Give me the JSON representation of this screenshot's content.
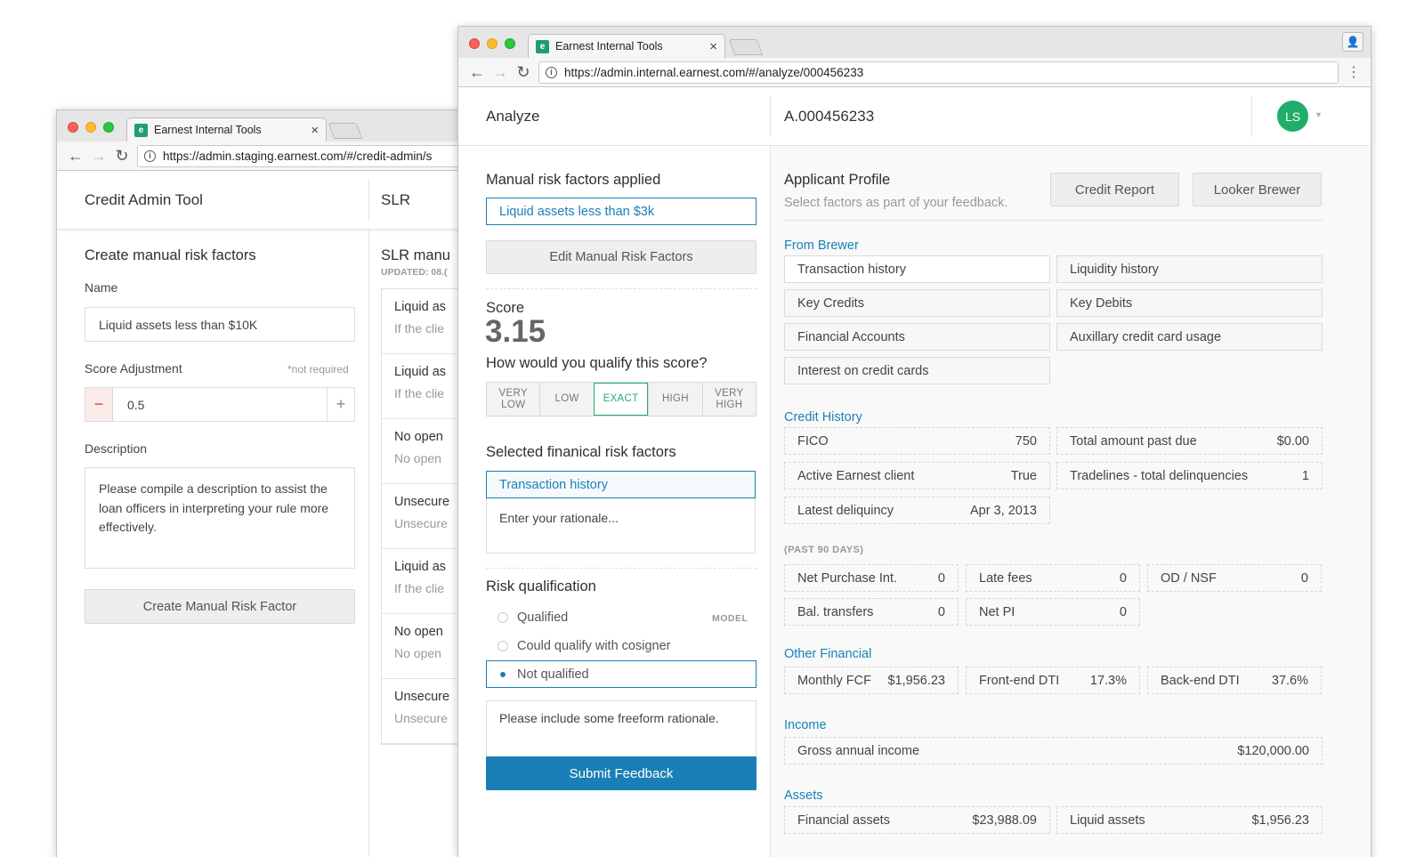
{
  "back_window": {
    "tab_title": "Earnest Internal Tools",
    "url": "https://admin.staging.earnest.com/#/credit-admin/s",
    "app_title": "Credit Admin Tool",
    "panel2_title": "SLR",
    "form": {
      "title": "Create manual risk factors",
      "name_label": "Name",
      "name_value": "Liquid assets less than $10K",
      "score_adj_label": "Score Adjustment",
      "not_required": "*not required",
      "score_value": "0.5",
      "minus": "−",
      "plus": "+",
      "description_label": "Description",
      "description_placeholder": "Please compile a description to assist the loan officers in interpreting your rule more effectively.",
      "create_button": "Create Manual Risk Factor"
    },
    "slr": {
      "title": "SLR manu",
      "updated": "UPDATED: 08.(",
      "items": [
        {
          "t": "Liquid as",
          "s": "If the clie"
        },
        {
          "t": "Liquid as",
          "s": "If the clie"
        },
        {
          "t": "No open",
          "s": "No open"
        },
        {
          "t": "Unsecure",
          "s": "Unsecure"
        },
        {
          "t": "Liquid as",
          "s": "If the clie"
        },
        {
          "t": "No open",
          "s": "No open"
        },
        {
          "t": "Unsecure",
          "s": "Unsecure"
        }
      ]
    }
  },
  "front_window": {
    "tab_title": "Earnest Internal Tools",
    "url": "https://admin.internal.earnest.com/#/analyze/000456233",
    "header": {
      "section": "Analyze",
      "app_id": "A.000456233",
      "avatar": "LS"
    },
    "left": {
      "manual_title": "Manual risk factors applied",
      "manual_selected": "Liquid assets less than $3k",
      "edit_button": "Edit Manual Risk Factors",
      "score_label": "Score",
      "score_value": "3.15",
      "qualify_question": "How would you qualify this score?",
      "qualify_options": [
        {
          "l1": "VERY",
          "l2": "LOW"
        },
        {
          "l1": "LOW",
          "l2": ""
        },
        {
          "l1": "EXACT",
          "l2": ""
        },
        {
          "l1": "HIGH",
          "l2": ""
        },
        {
          "l1": "VERY",
          "l2": "HIGH"
        }
      ],
      "qualify_selected": "EXACT",
      "selected_title": "Selected finanical risk factors",
      "selected_factor": "Transaction history",
      "rationale_placeholder": "Enter your rationale...",
      "risk_title": "Risk qualification",
      "model_tag": "MODEL",
      "risk_options": [
        "Qualified",
        "Could qualify with cosigner",
        "Not qualified"
      ],
      "risk_selected": "Not qualified",
      "freeform_placeholder": "Please include some freeform rationale.",
      "submit_button": "Submit Feedback"
    },
    "right": {
      "title": "Applicant Profile",
      "subtitle": "Select factors as part of your feedback.",
      "credit_report_button": "Credit Report",
      "looker_button": "Looker Brewer",
      "from_brewer_label": "From Brewer",
      "brewer_items": [
        "Transaction history",
        "Liquidity history",
        "Key Credits",
        "Key Debits",
        "Financial Accounts",
        "Auxillary credit card usage",
        "Interest on credit cards"
      ],
      "brewer_selected": "Transaction history",
      "credit_history_label": "Credit History",
      "credit_history": [
        {
          "k": "FICO",
          "v": "750"
        },
        {
          "k": "Total amount past due",
          "v": "$0.00"
        },
        {
          "k": "Active Earnest client",
          "v": "True"
        },
        {
          "k": "Tradelines - total delinquencies",
          "v": "1"
        },
        {
          "k": "Latest deliquincy",
          "v": "Apr 3, 2013"
        }
      ],
      "past90_label": "(PAST 90 DAYS)",
      "past90": [
        {
          "k": "Net Purchase Int.",
          "v": "0"
        },
        {
          "k": "Late fees",
          "v": "0"
        },
        {
          "k": "OD / NSF",
          "v": "0"
        },
        {
          "k": "Bal. transfers",
          "v": "0"
        },
        {
          "k": "Net PI",
          "v": "0"
        }
      ],
      "other_label": "Other Financial",
      "other": [
        {
          "k": "Monthly FCF",
          "v": "$1,956.23"
        },
        {
          "k": "Front-end DTI",
          "v": "17.3%"
        },
        {
          "k": "Back-end DTI",
          "v": "37.6%"
        }
      ],
      "income_label": "Income",
      "income": [
        {
          "k": "Gross annual income",
          "v": "$120,000.00"
        }
      ],
      "assets_label": "Assets",
      "assets": [
        {
          "k": "Financial assets",
          "v": "$23,988.09"
        },
        {
          "k": "Liquid assets",
          "v": "$1,956.23"
        }
      ]
    }
  }
}
